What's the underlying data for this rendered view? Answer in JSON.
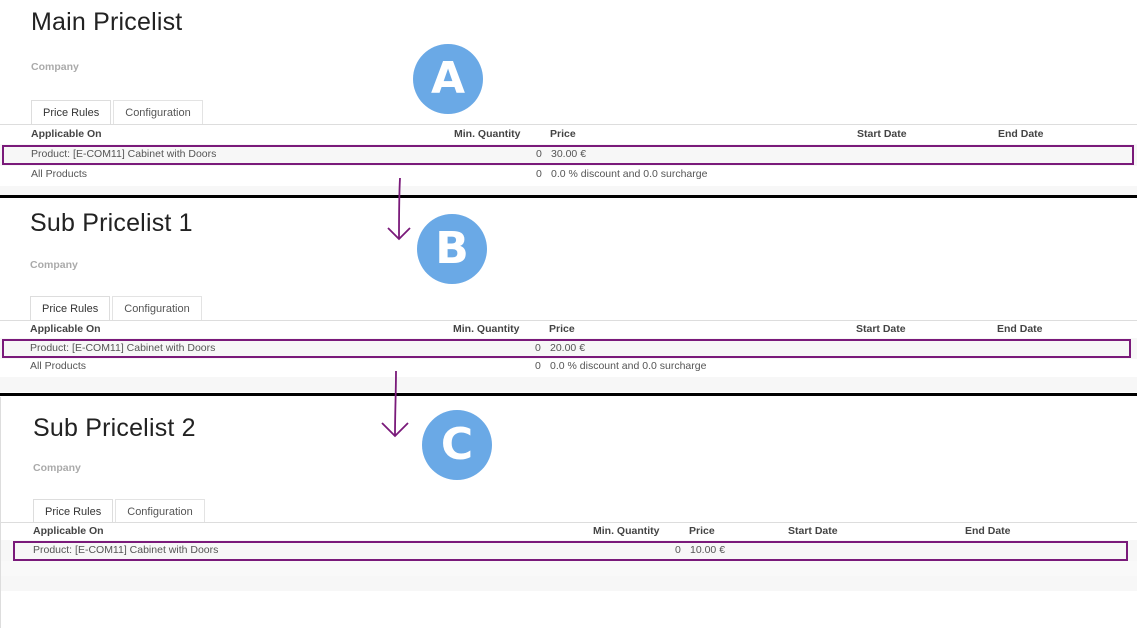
{
  "columns": {
    "applicable_on": "Applicable On",
    "min_quantity": "Min. Quantity",
    "price": "Price",
    "start_date": "Start Date",
    "end_date": "End Date"
  },
  "company_label": "Company",
  "tabs": {
    "price_rules": "Price Rules",
    "configuration": "Configuration"
  },
  "markers": {
    "a": "A",
    "b": "B",
    "c": "C"
  },
  "colors": {
    "marker": "#6aa9e6",
    "highlight": "#7a1a7a",
    "divider": "#000000"
  },
  "pricelists": [
    {
      "title": "Main Pricelist",
      "rows": [
        {
          "applicable_on": "Product: [E-COM11] Cabinet with Doors",
          "min_quantity": "0",
          "price": "30.00 €"
        },
        {
          "applicable_on": "All Products",
          "min_quantity": "0",
          "price": "0.0 % discount and 0.0 surcharge"
        }
      ]
    },
    {
      "title": "Sub Pricelist 1",
      "rows": [
        {
          "applicable_on": "Product: [E-COM11] Cabinet with Doors",
          "min_quantity": "0",
          "price": "20.00 €"
        },
        {
          "applicable_on": "All Products",
          "min_quantity": "0",
          "price": "0.0 % discount and 0.0 surcharge"
        }
      ]
    },
    {
      "title": "Sub Pricelist 2",
      "rows": [
        {
          "applicable_on": "Product: [E-COM11] Cabinet with Doors",
          "min_quantity": "0",
          "price": "10.00 €"
        }
      ]
    }
  ]
}
